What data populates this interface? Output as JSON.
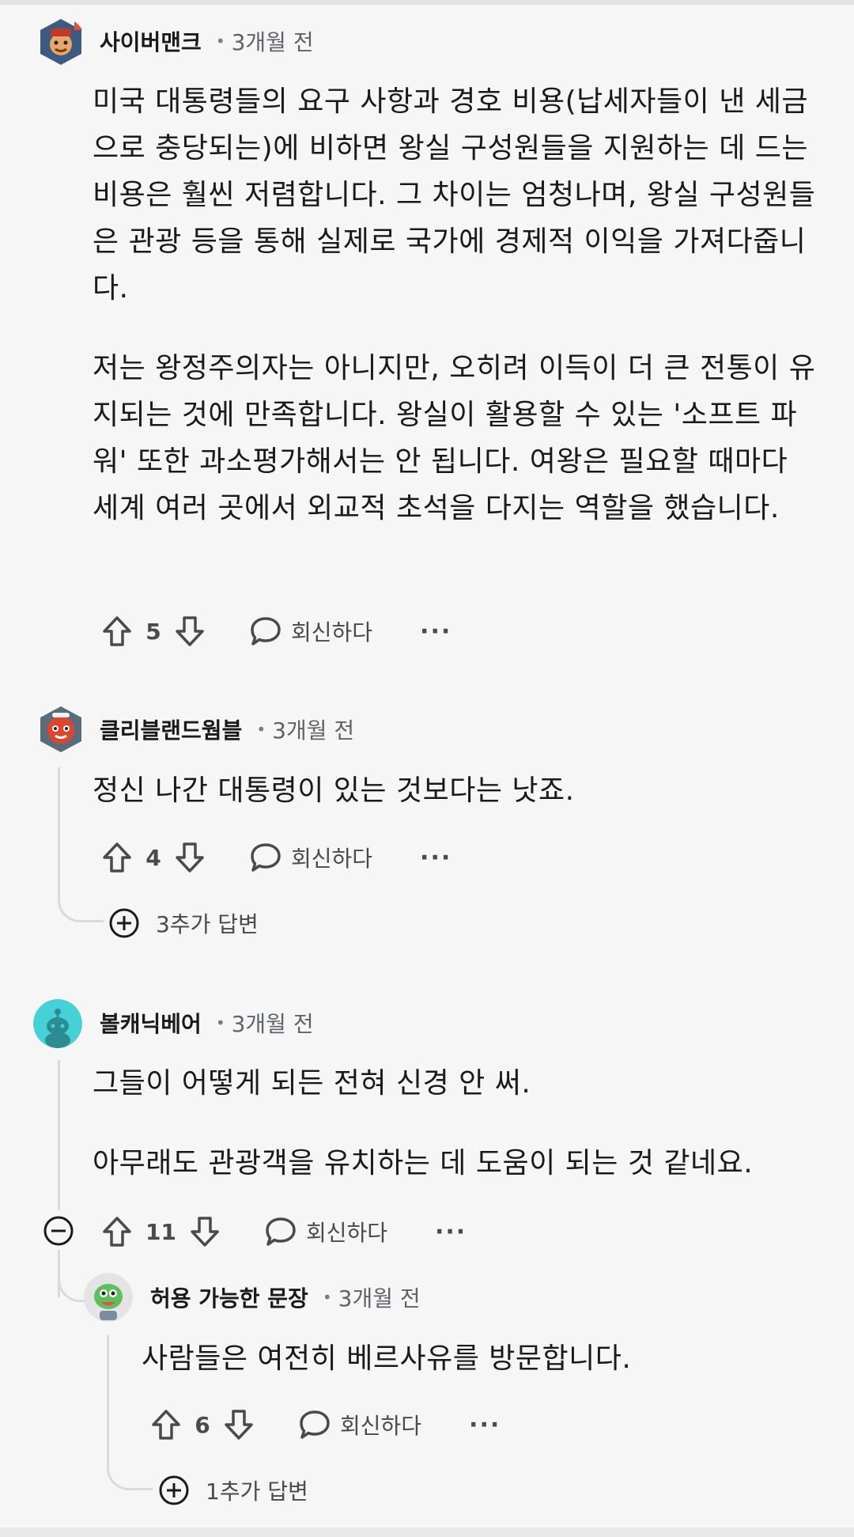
{
  "comments": [
    {
      "author": "사이버맨크",
      "age": "3개월 전",
      "paragraphs": [
        "미국 대통령들의 요구 사항과 경호 비용(납세자들이 낸 세금으로 충당되는)에 비하면 왕실 구성원들을 지원하는 데 드는 비용은 훨씬 저렴합니다. 그 차이는 엄청나며, 왕실 구성원들은 관광 등을 통해 실제로 국가에 경제적 이익을 가져다줍니다.",
        "저는 왕정주의자는 아니지만, 오히려 이득이 더 큰 전통이 유지되는 것에 만족합니다. 왕실이 활용할 수 있는 '소프트 파워' 또한 과소평가해서는 안 됩니다. 여왕은 필요할 때마다 세계 여러 곳에서 외교적 초석을 다지는 역할을 했습니다."
      ],
      "votes": "5",
      "reply_label": "회신하다",
      "more": "···"
    },
    {
      "author": "클리블랜드웜블",
      "age": "3개월 전",
      "text": "정신 나간 대통령이 있는 것보다는 낫죠.",
      "votes": "4",
      "reply_label": "회신하다",
      "more": "···",
      "more_replies": "3추가 답변"
    },
    {
      "author": "볼캐닉베어",
      "age": "3개월 전",
      "paragraphs": [
        "그들이 어떻게 되든 전혀 신경 안 써.",
        "아무래도 관광객을 유치하는 데 도움이 되는 것 같네요."
      ],
      "votes": "11",
      "reply_label": "회신하다",
      "more": "···"
    },
    {
      "author": "허용 가능한 문장",
      "age": "3개월 전",
      "text": "사람들은 여전히 베르사유를 방문합니다.",
      "votes": "6",
      "reply_label": "회신하다",
      "more": "···",
      "more_replies": "1추가 답변"
    }
  ],
  "separator": "•",
  "icons": {
    "upvote": "arrow-up-outline-icon",
    "downvote": "arrow-down-outline-icon",
    "reply": "speech-bubble-icon",
    "expand": "plus-circle-icon",
    "collapse": "minus-circle-icon"
  },
  "colors": {
    "background": "#f6f6f6",
    "text": "#1a1a1b",
    "muted": "#5f6368",
    "thread_line": "#dadada"
  }
}
